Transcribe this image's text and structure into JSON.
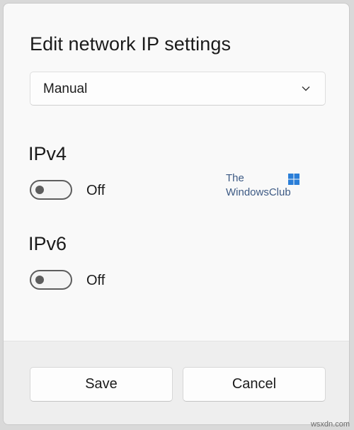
{
  "dialog": {
    "title": "Edit network IP settings",
    "mode_select": {
      "value": "Manual"
    }
  },
  "ipv4": {
    "label": "IPv4",
    "state_text": "Off",
    "on": false
  },
  "ipv6": {
    "label": "IPv6",
    "state_text": "Off",
    "on": false
  },
  "watermark": {
    "line1": "The",
    "line2": "WindowsClub"
  },
  "footer": {
    "save_label": "Save",
    "cancel_label": "Cancel"
  },
  "site_mark": "wsxdn.com",
  "colors": {
    "toggle_off": "#5d5d5d",
    "watermark_text": "#3d5a84",
    "logo_blue": "#2a7ed8"
  },
  "icons": {
    "dropdown": "chevron-down-icon",
    "brand": "windows-logo-icon"
  }
}
